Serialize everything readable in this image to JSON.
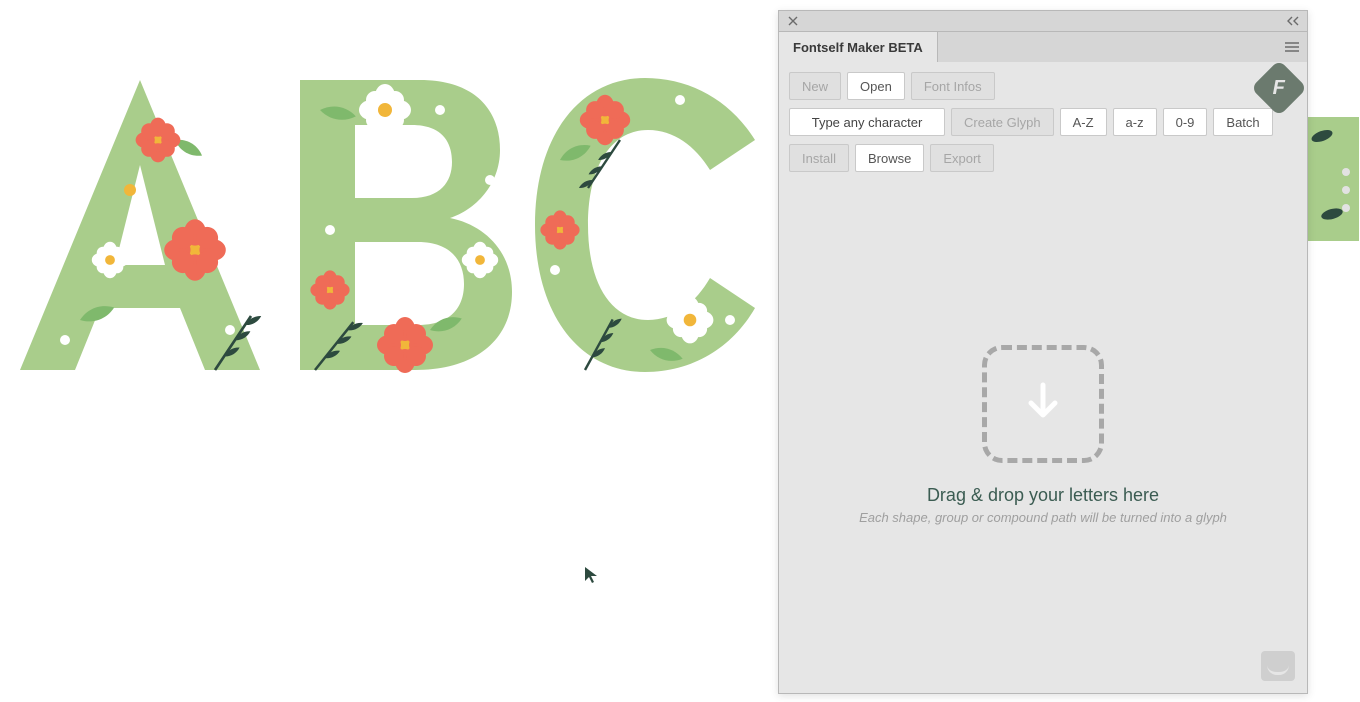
{
  "panel": {
    "title": "Fontself Maker BETA",
    "row1": {
      "new": "New",
      "open": "Open",
      "fontinfos": "Font Infos"
    },
    "row2": {
      "input_placeholder": "Type any character",
      "create": "Create Glyph",
      "az_upper": "A-Z",
      "az_lower": "a-z",
      "digits": "0-9",
      "batch": "Batch"
    },
    "row3": {
      "install": "Install",
      "browse": "Browse",
      "export": "Export"
    },
    "drop": {
      "title": "Drag & drop your letters here",
      "subtitle": "Each shape, group or compound path will be turned into a glyph"
    }
  },
  "canvas": {
    "letters": "ABC"
  }
}
